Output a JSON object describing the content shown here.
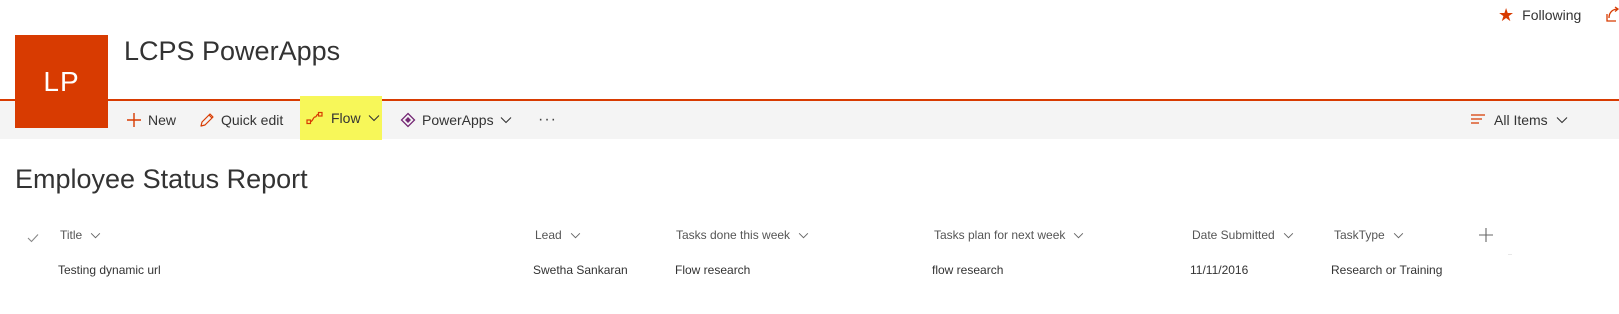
{
  "topbar": {
    "following_label": "Following"
  },
  "site": {
    "logo_initials": "LP",
    "title": "LCPS PowerApps",
    "accent_color": "#d83b01"
  },
  "command_bar": {
    "new_label": "New",
    "quick_edit_label": "Quick edit",
    "flow_label": "Flow",
    "powerapps_label": "PowerApps",
    "more_label": "···",
    "view_label": "All Items",
    "highlight_color": "#f7f759"
  },
  "list": {
    "title": "Employee Status Report",
    "columns": [
      "Title",
      "Lead",
      "Tasks done this week",
      "Tasks plan for next week",
      "Date Submitted",
      "TaskType"
    ],
    "rows": [
      {
        "title": "Testing dynamic url",
        "lead": "Swetha Sankaran",
        "tasks_done": "Flow research",
        "tasks_plan": "flow research",
        "date_submitted": "11/11/2016",
        "task_type": "Research or Training"
      }
    ]
  },
  "icons": {
    "following": "star-icon",
    "share": "share-icon",
    "new": "plus-icon",
    "quick_edit": "pencil-icon",
    "flow": "flow-icon",
    "powerapps": "powerapps-icon",
    "view": "view-lines-icon",
    "add_column": "plus-icon",
    "select_all": "checkmark-icon"
  }
}
